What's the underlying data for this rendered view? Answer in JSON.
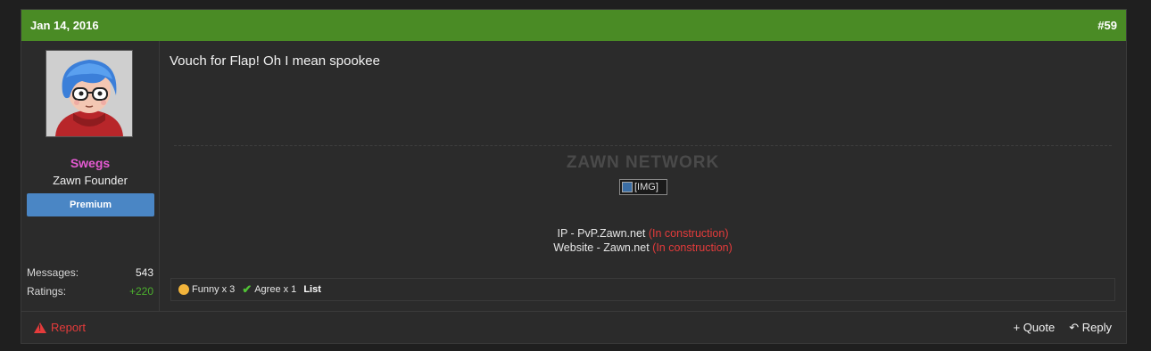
{
  "post": {
    "date": "Jan 14, 2016",
    "number": "#59",
    "message": "Vouch for Flap! Oh I mean spookee"
  },
  "user": {
    "name": "Swegs",
    "title": "Zawn Founder",
    "banner": "Premium",
    "stats": [
      {
        "label": "Messages:",
        "value": "543"
      },
      {
        "label": "Ratings:",
        "value": "+220"
      }
    ],
    "colors": {
      "username": "#e55ad2",
      "banner": "#4a86c5",
      "ratings": "#4caf2e"
    }
  },
  "signature": {
    "title": "ZAWN NETWORK",
    "image_alt": "[IMG]",
    "lines": [
      {
        "text": "IP - PvP.Zawn.net",
        "note": "(In construction)"
      },
      {
        "text": "Website - Zawn.net",
        "note": "(In construction)"
      }
    ]
  },
  "reactions": {
    "items": [
      {
        "icon": "funny-emoji-icon",
        "label": "Funny x 3"
      },
      {
        "icon": "checkmark-icon",
        "label": "Agree x 1"
      }
    ],
    "list_label": "List"
  },
  "footer": {
    "report": "Report",
    "quote": "+ Quote",
    "reply": "Reply"
  },
  "theme": {
    "header": "#4a8b25",
    "accent_red": "#e53b3b"
  }
}
